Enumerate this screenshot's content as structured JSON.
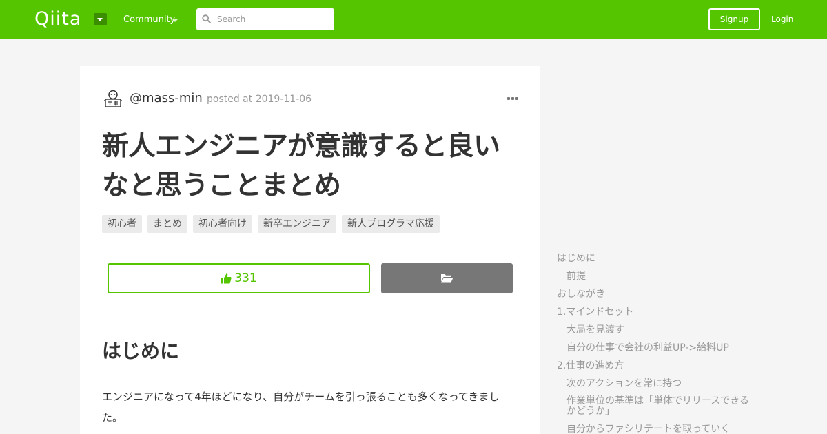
{
  "header": {
    "logo": "Qiita",
    "community_label": "Community",
    "search_placeholder": "Search",
    "signup_label": "Signup",
    "login_label": "Login",
    "brand_color": "#55c500"
  },
  "article": {
    "author": "@mass-min",
    "posted": "posted at 2019-11-06",
    "title": "新人エンジニアが意識すると良いなと思うことまとめ",
    "tags": [
      "初心者",
      "まとめ",
      "初心者向け",
      "新卒エンジニア",
      "新人プログラマ応援"
    ],
    "likes": "331",
    "section_heading": "はじめに",
    "paragraph": "エンジニアになって4年ほどになり、自分がチームを引っ張ることも多くなってきました。"
  },
  "toc": [
    {
      "label": "はじめに",
      "level": 1
    },
    {
      "label": "前提",
      "level": 2
    },
    {
      "label": "おしながき",
      "level": 1
    },
    {
      "label": "1.マインドセット",
      "level": 1
    },
    {
      "label": "大局を見渡す",
      "level": 2
    },
    {
      "label": "自分の仕事で会社の利益UP->給料UP",
      "level": 2
    },
    {
      "label": "2.仕事の進め方",
      "level": 1
    },
    {
      "label": "次のアクションを常に持つ",
      "level": 2
    },
    {
      "label": "作業単位の基準は「単体でリリースできるかどうか」",
      "level": 2
    },
    {
      "label": "自分からファシリテートを取っていく",
      "level": 2
    }
  ]
}
